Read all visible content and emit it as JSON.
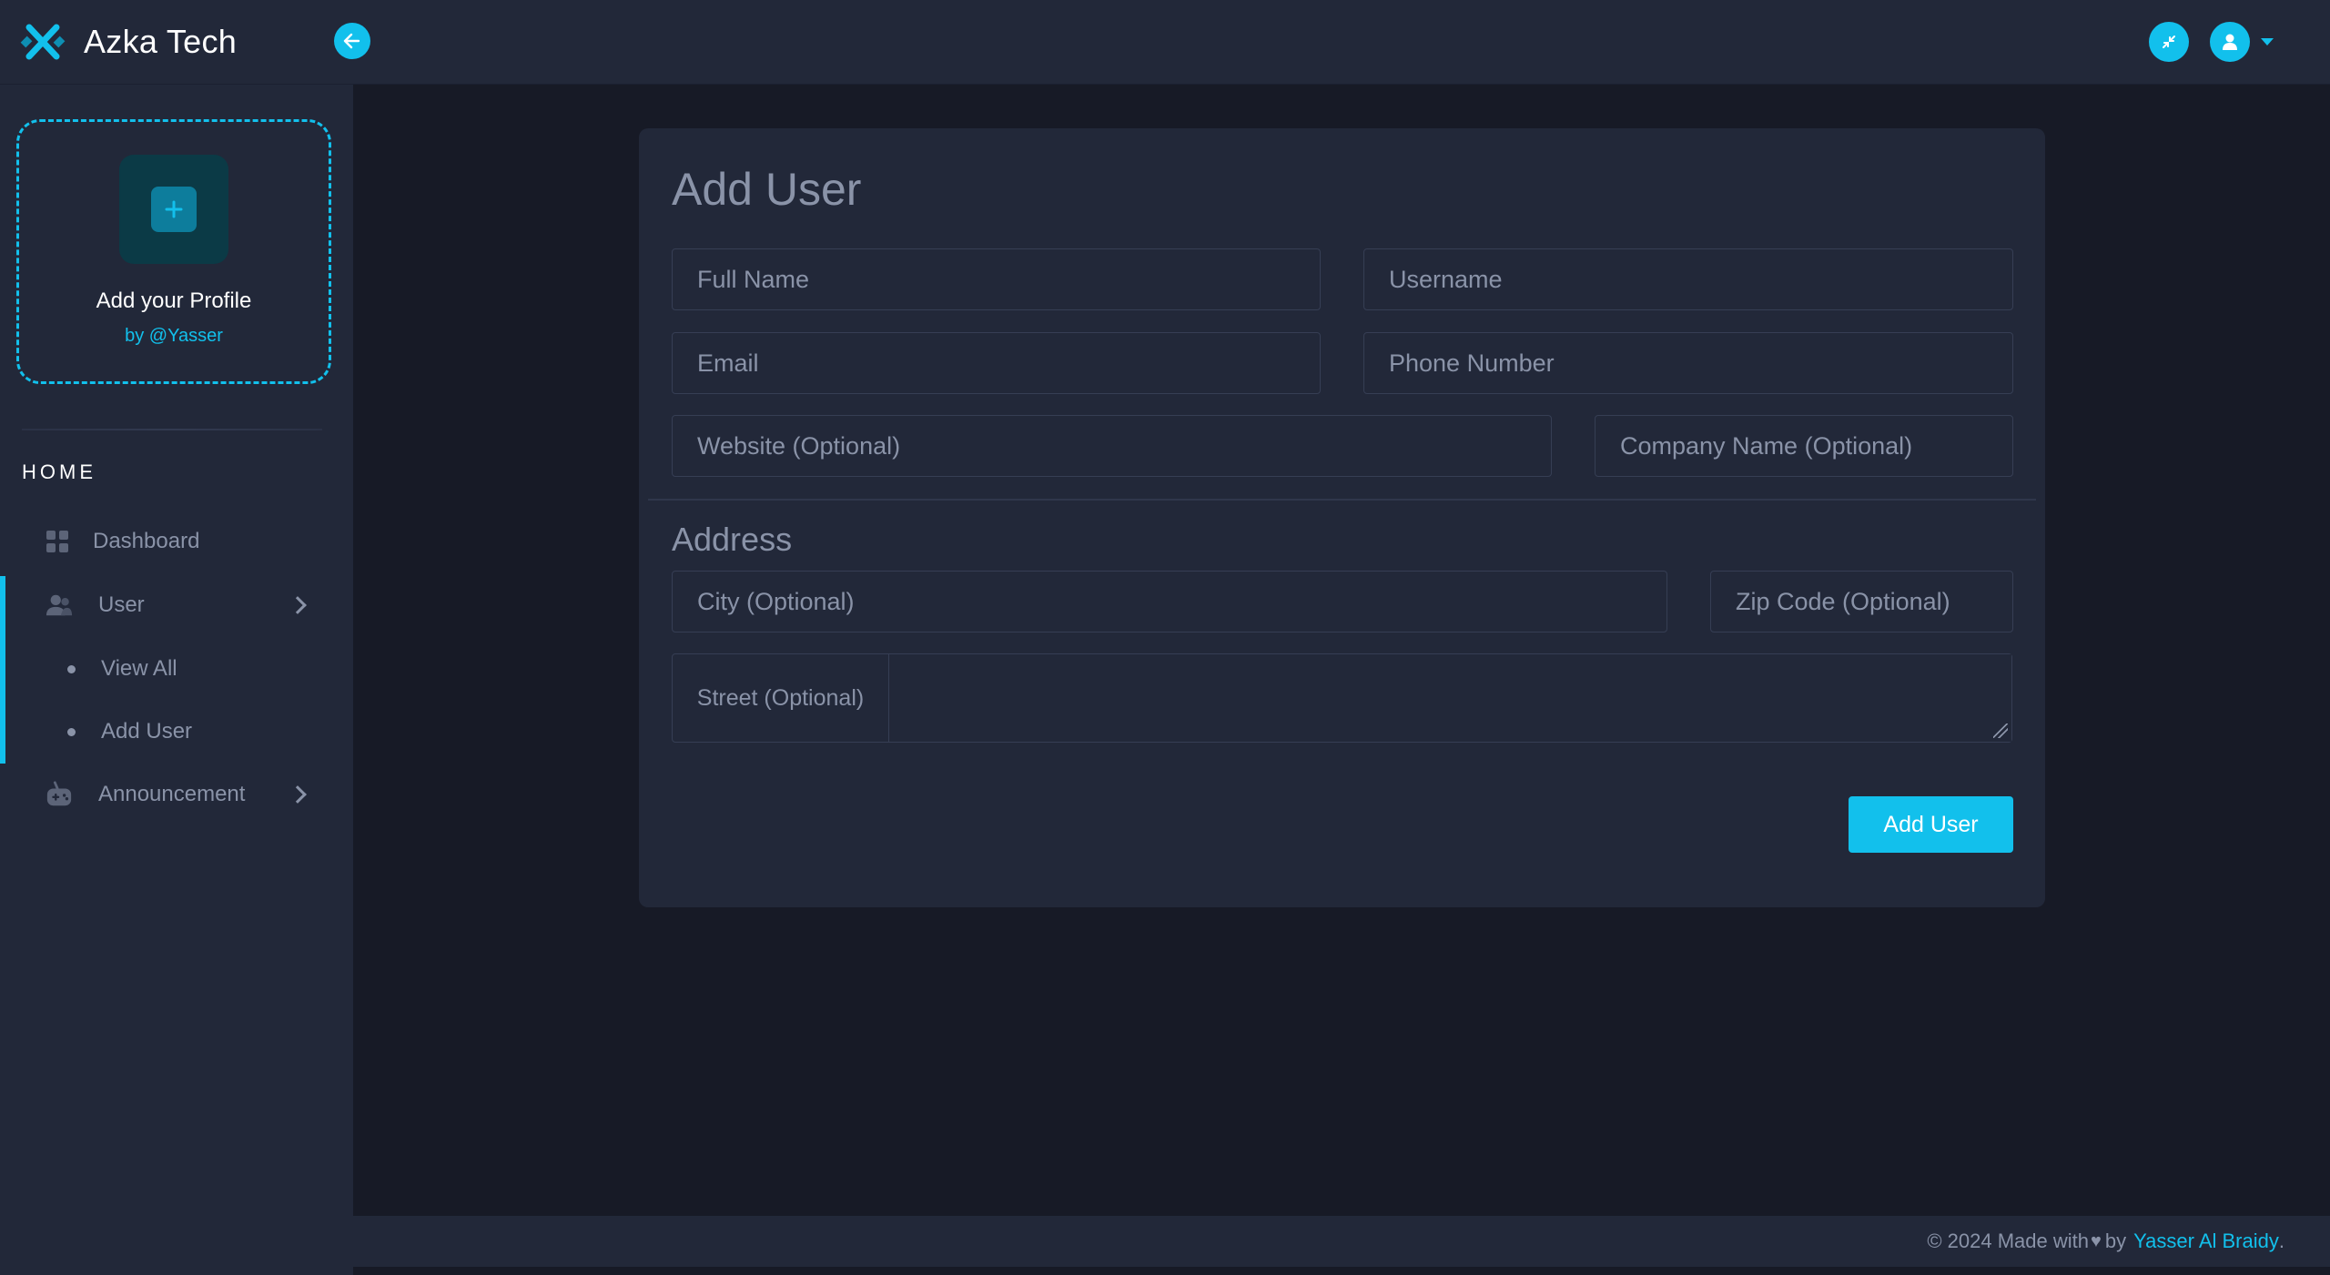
{
  "app": {
    "brand_name": "Azka Tech"
  },
  "colors": {
    "accent": "#12c0ec",
    "surface": "#222839",
    "background": "#171a26",
    "muted_text": "#8a93a8"
  },
  "header": {
    "back_icon": "arrow-left-icon",
    "fullscreen_icon": "minimize-icon",
    "user_icon": "user-icon"
  },
  "sidebar": {
    "profile": {
      "title": "Add your Profile",
      "by": "by @Yasser",
      "icon": "plus-icon"
    },
    "section_label": "HOME",
    "items": [
      {
        "label": "Dashboard",
        "icon": "dashboard-grid-icon"
      },
      {
        "label": "User",
        "icon": "users-icon",
        "expanded": true,
        "children": [
          {
            "label": "View All"
          },
          {
            "label": "Add User"
          }
        ]
      },
      {
        "label": "Announcement",
        "icon": "game-controller-icon"
      }
    ]
  },
  "form": {
    "title": "Add User",
    "fields": {
      "full_name": "Full Name",
      "username": "Username",
      "email": "Email",
      "phone": "Phone Number",
      "website": "Website (Optional)",
      "company": "Company Name (Optional)"
    },
    "address": {
      "title": "Address",
      "city": "City (Optional)",
      "zip": "Zip Code (Optional)",
      "street_label": "Street (Optional)"
    },
    "submit_label": "Add User"
  },
  "footer": {
    "text": "© 2024 Made with",
    "heart_icon": "heart-icon",
    "by": "by",
    "author": "Yasser Al Braidy",
    "suffix": "."
  }
}
